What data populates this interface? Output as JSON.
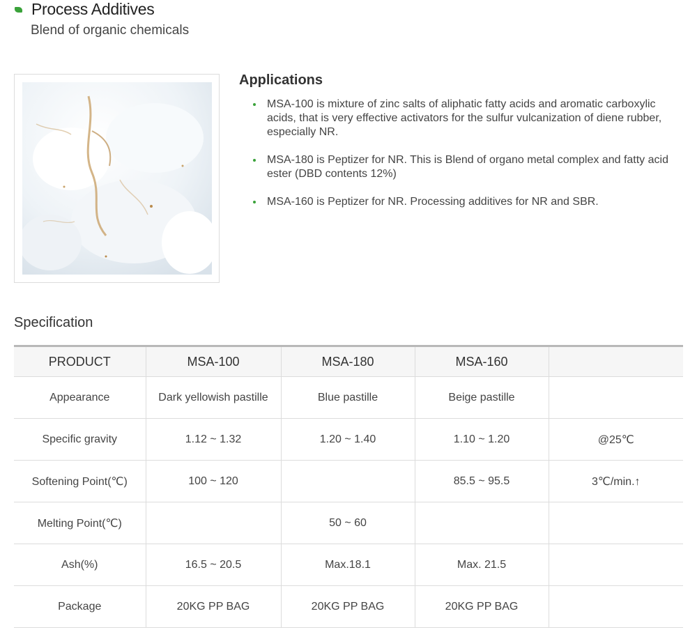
{
  "header": {
    "title": "Process Additives",
    "subtitle": "Blend of organic chemicals"
  },
  "applications": {
    "heading": "Applications",
    "items": [
      "MSA-100 is mixture of zinc salts of aliphatic fatty acids and aromatic carboxylic acids, that is very effective activators for the sulfur vulcanization of diene rubber, especially NR.",
      "MSA-180 is Peptizer for NR. This is Blend of organo metal complex and fatty acid ester (DBD contents  12%)",
      "MSA-160 is Peptizer for NR. Processing additives for NR and SBR."
    ]
  },
  "specification": {
    "heading": "Specification",
    "columns": [
      "PRODUCT",
      "MSA-100",
      "MSA-180",
      "MSA-160",
      ""
    ],
    "rows": [
      [
        "Appearance",
        "Dark yellowish pastille",
        "Blue pastille",
        "Beige pastille",
        ""
      ],
      [
        "Specific gravity",
        "1.12 ~ 1.32",
        "1.20 ~ 1.40",
        "1.10 ~ 1.20",
        "@25℃"
      ],
      [
        "Softening Point(℃)",
        "100 ~ 120",
        "",
        "85.5 ~ 95.5",
        "3℃/min.↑"
      ],
      [
        "Melting Point(℃)",
        "",
        "50 ~ 60",
        "",
        ""
      ],
      [
        "Ash(%)",
        "16.5 ~ 20.5",
        "Max.18.1",
        "Max. 21.5",
        ""
      ],
      [
        "Package",
        "20KG PP BAG",
        "20KG PP BAG",
        "20KG PP BAG",
        ""
      ]
    ]
  },
  "colors": {
    "accent": "#3aa23a",
    "table_header_bg": "#f6f6f6",
    "table_top_border": "#b8b8b8"
  }
}
